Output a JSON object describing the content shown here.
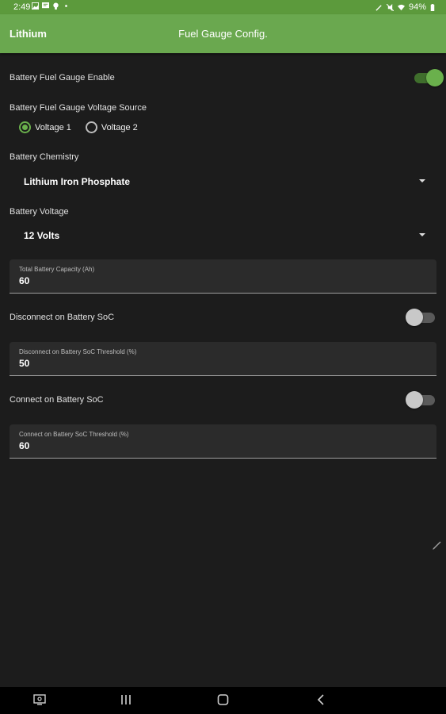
{
  "status_bar": {
    "time": "2:49",
    "battery": "94%",
    "left_icons": [
      "image-icon",
      "message-icon",
      "bulb-icon",
      "dot-icon"
    ],
    "right_icons": [
      "pen-icon",
      "mute-icon",
      "wifi-icon",
      "battery-icon"
    ]
  },
  "app_bar": {
    "app_name": "Lithium",
    "title": "Fuel Gauge Config."
  },
  "fuel_gauge": {
    "enable_label": "Battery Fuel Gauge Enable",
    "enabled": true
  },
  "voltage_source": {
    "label": "Battery Fuel Gauge Voltage Source",
    "options": [
      "Voltage 1",
      "Voltage 2"
    ],
    "selected": "Voltage 1"
  },
  "chemistry": {
    "label": "Battery Chemistry",
    "value": "Lithium Iron Phosphate"
  },
  "voltage": {
    "label": "Battery Voltage",
    "value": "12 Volts"
  },
  "capacity": {
    "label": "Total Battery Capacity (Ah)",
    "value": "60"
  },
  "disconnect": {
    "label": "Disconnect on Battery SoC",
    "enabled": false,
    "threshold_label": "Disconnect on Battery SoC Threshold (%)",
    "threshold_value": "50"
  },
  "connect": {
    "label": "Connect on Battery SoC",
    "enabled": false,
    "threshold_label": "Connect on Battery SoC Threshold (%)",
    "threshold_value": "60"
  },
  "colors": {
    "status_bar": "#5c9a3c",
    "app_bar": "#6aa84f",
    "accent": "#6ab04c",
    "background": "#1c1c1c",
    "field_background": "#2b2b2b"
  },
  "nav_bar": {
    "buttons": [
      "screenshot-icon",
      "recents-icon",
      "home-icon",
      "back-icon"
    ]
  }
}
